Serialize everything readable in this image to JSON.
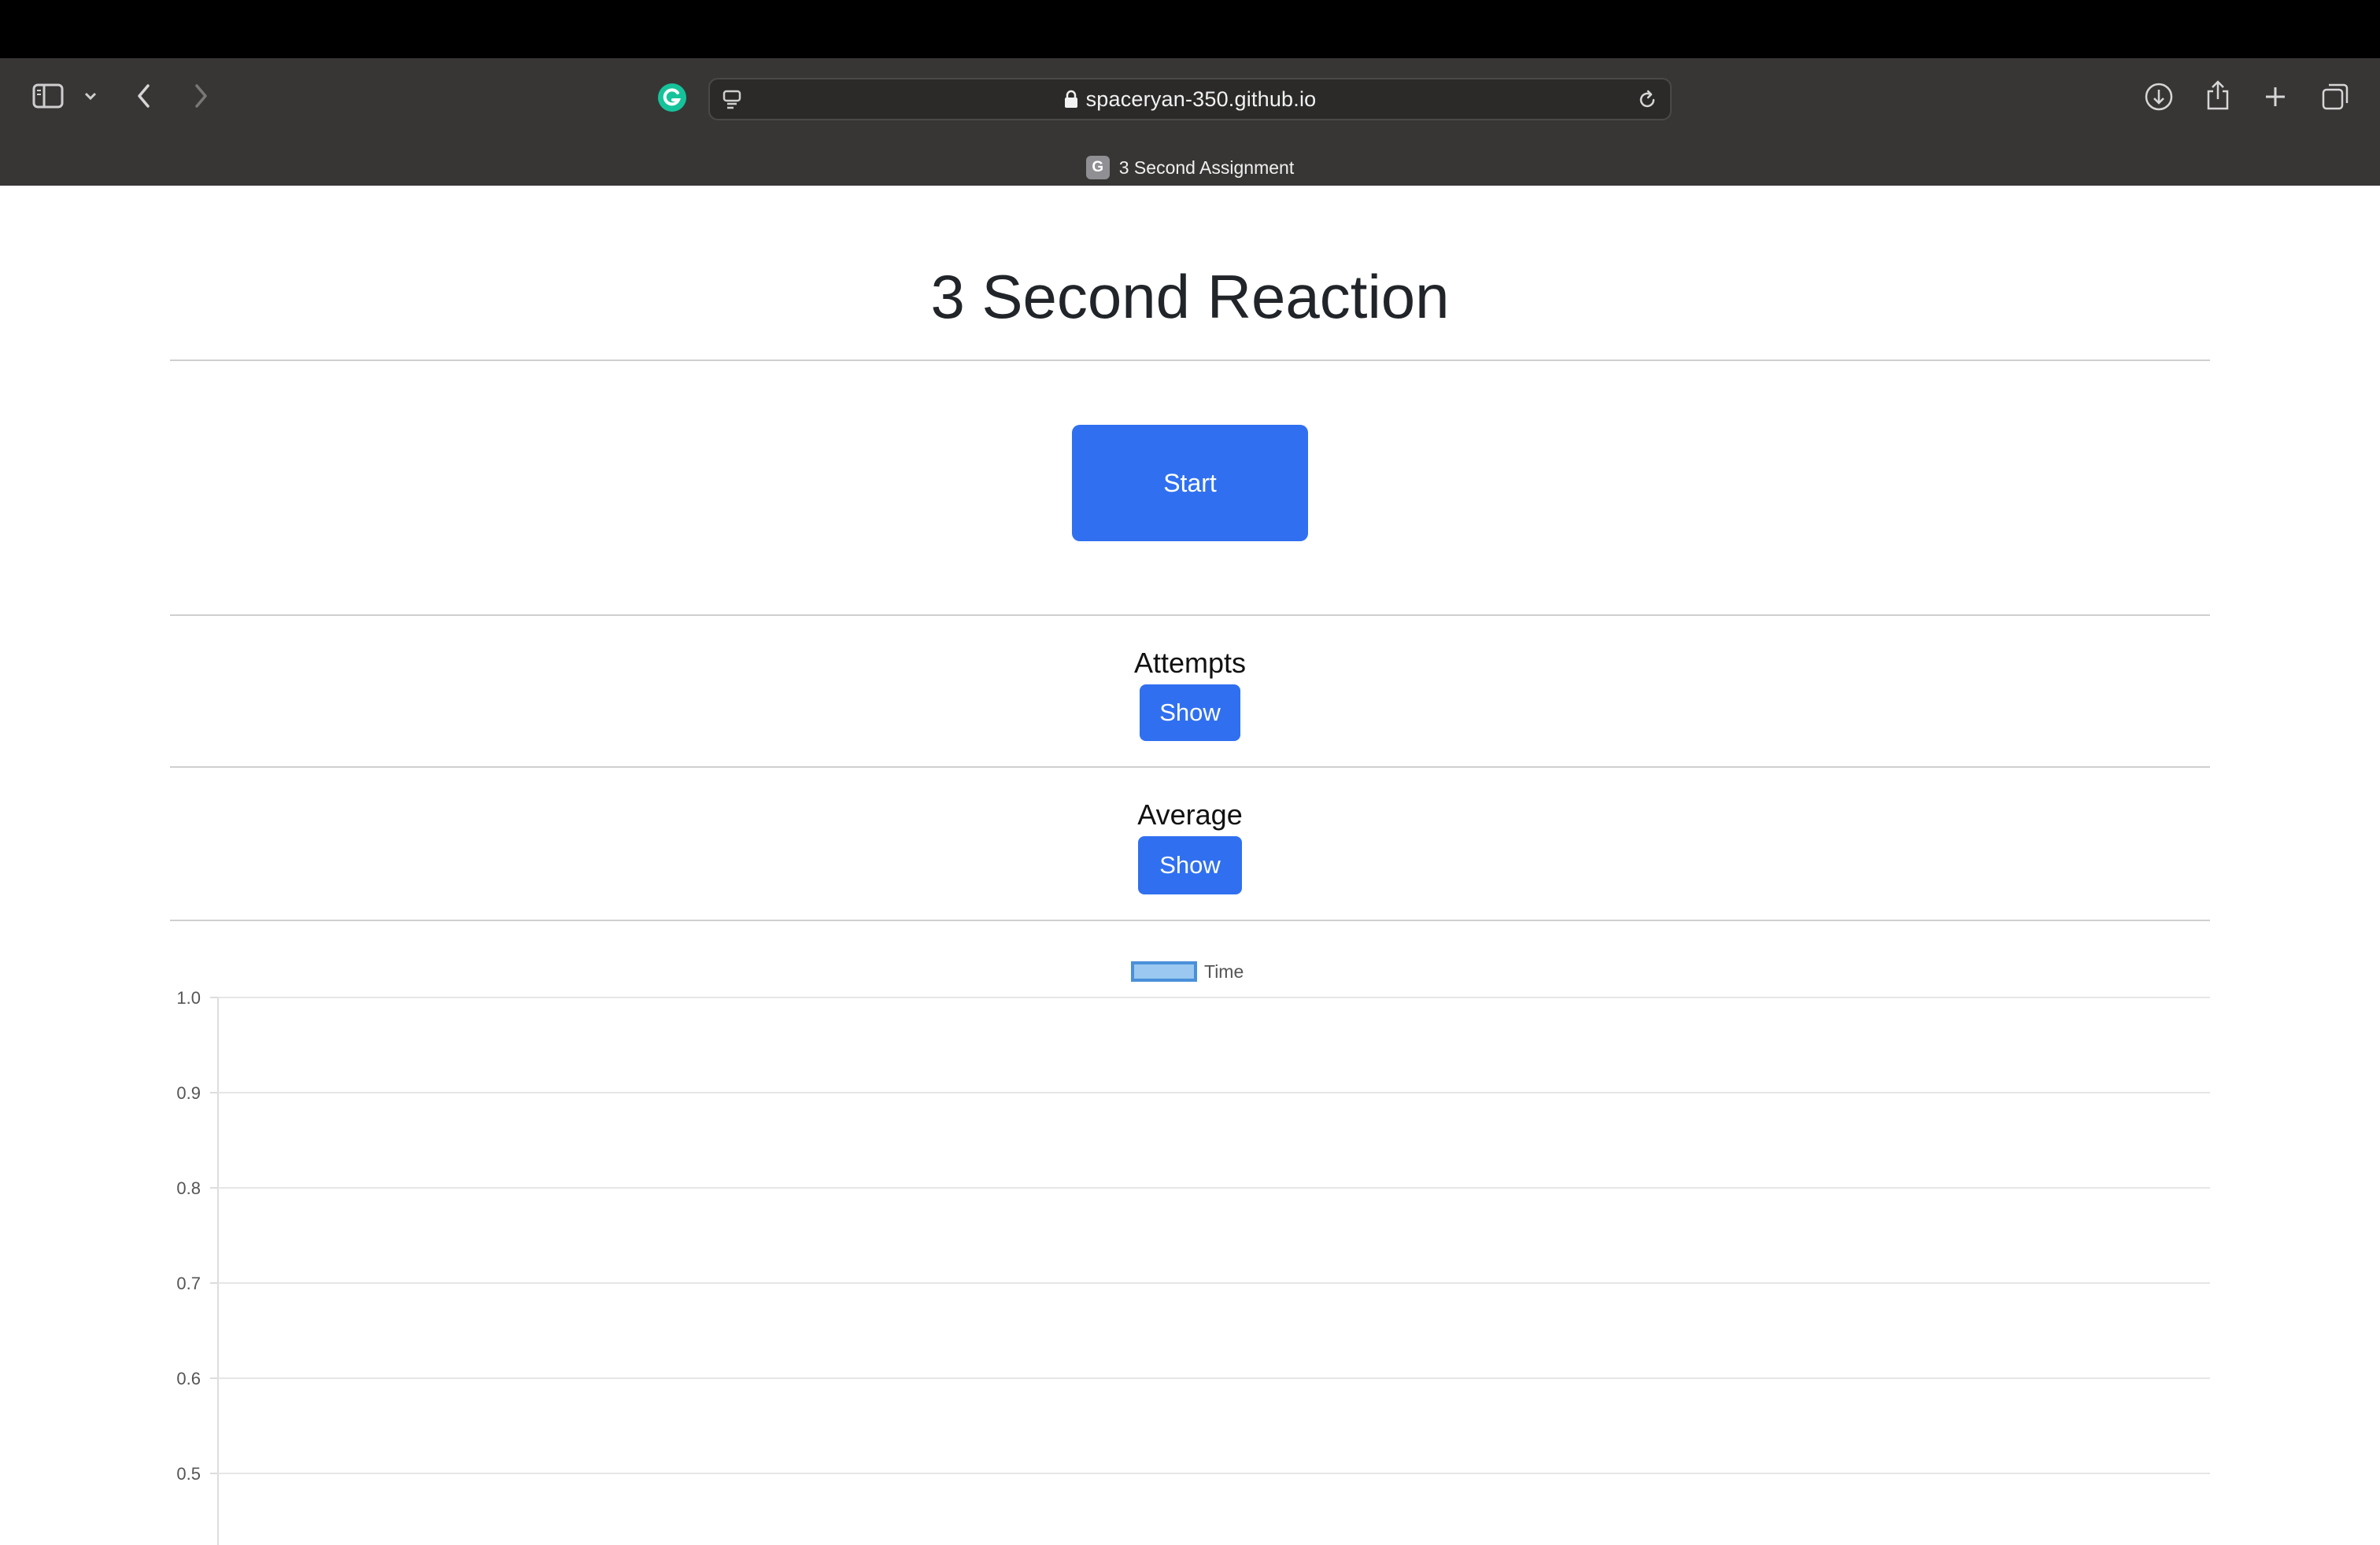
{
  "browser": {
    "url": "spaceryan-350.github.io",
    "tab_title": "3 Second Assignment",
    "tab_favicon_letter": "G"
  },
  "page": {
    "title": "3 Second Reaction",
    "start_button": "Start",
    "attempts": {
      "label": "Attempts",
      "button": "Show"
    },
    "average": {
      "label": "Average",
      "button": "Show"
    }
  },
  "chart_data": {
    "type": "bar",
    "legend": [
      "Time"
    ],
    "series": [
      {
        "name": "Time",
        "values": [],
        "color": "#9ac8f0",
        "border_color": "#4a90d9"
      }
    ],
    "y_ticks": [
      "1.0",
      "0.9",
      "0.8",
      "0.7",
      "0.6",
      "0.5"
    ],
    "ylim": [
      0.5,
      1.0
    ],
    "grid": true,
    "legend_position": "top-center"
  }
}
